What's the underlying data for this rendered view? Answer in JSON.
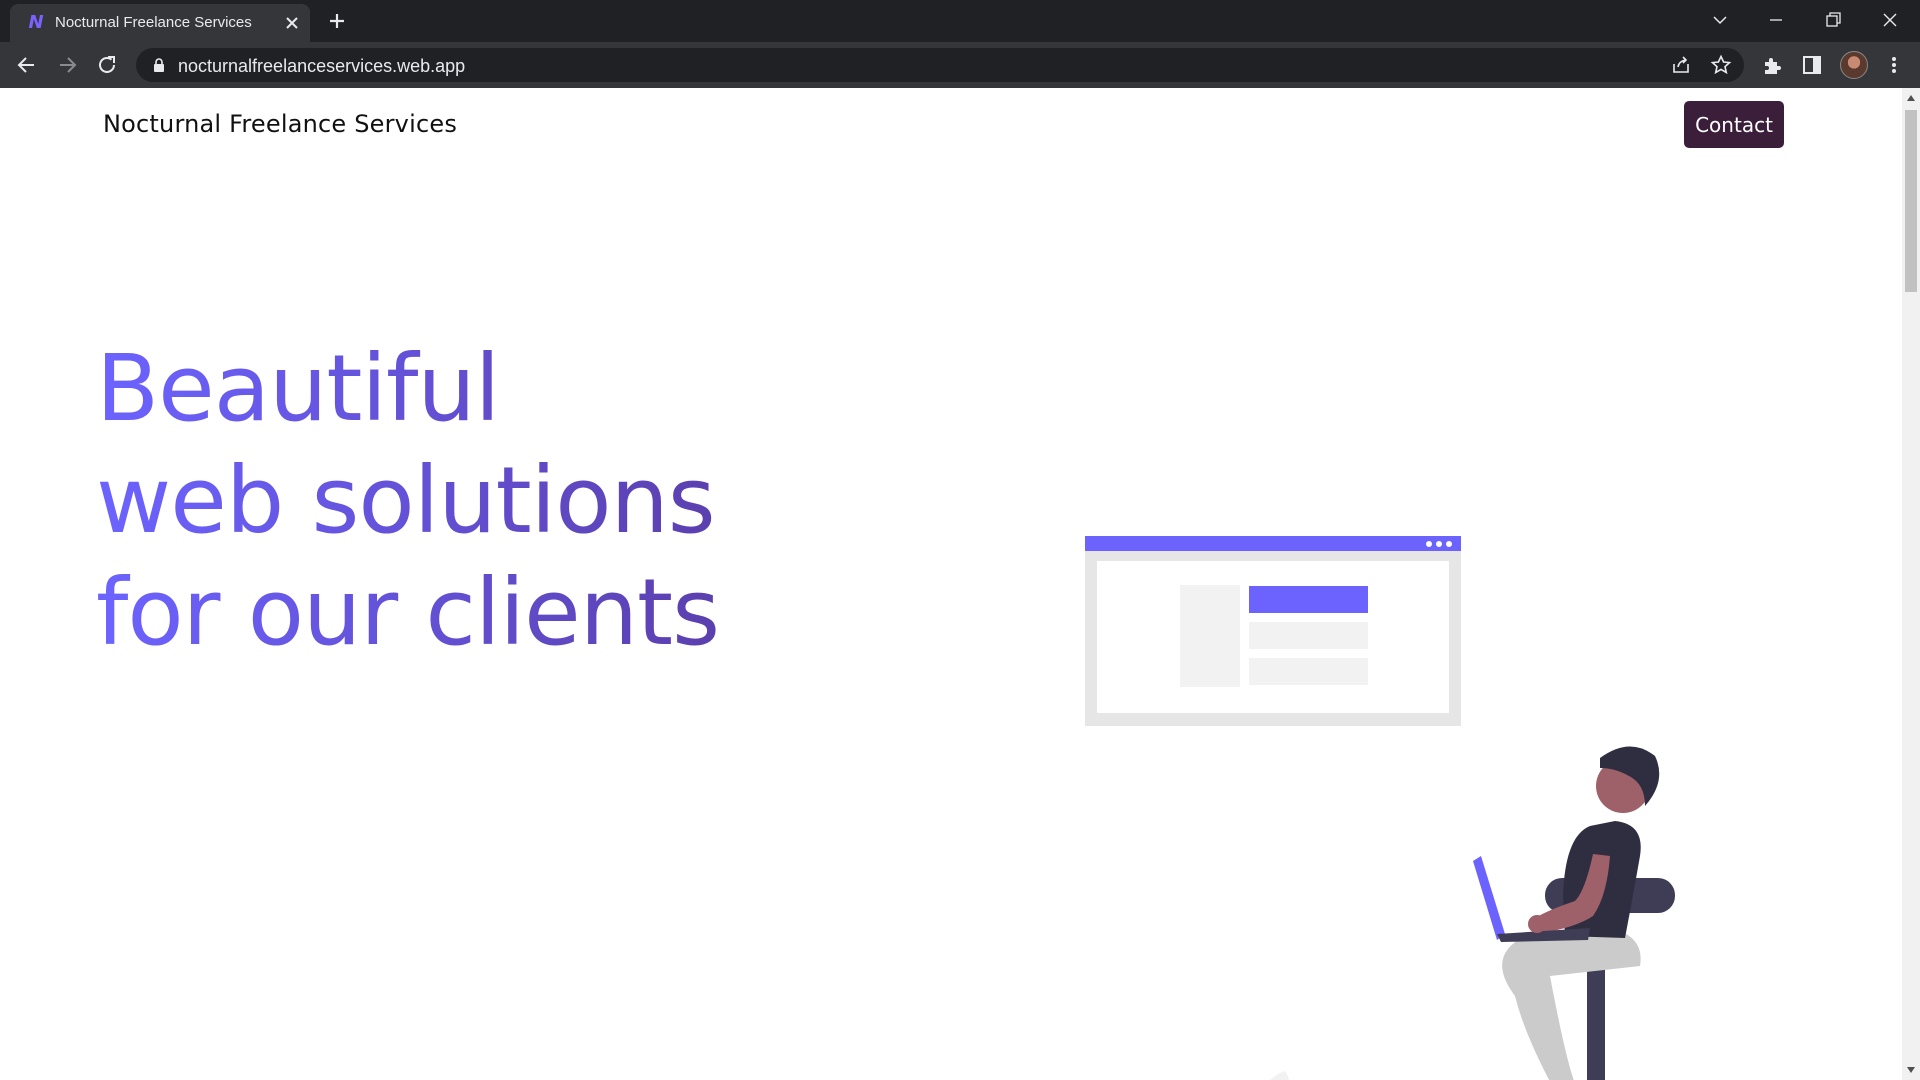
{
  "browser": {
    "tab_title": "Nocturnal Freelance Services",
    "favicon_letter": "N",
    "url": "nocturnalfreelanceservices.web.app",
    "icons": [
      "close-icon",
      "plus-icon",
      "chevron-down-icon",
      "minimize-icon",
      "restore-icon",
      "window-close-icon",
      "back-arrow-icon",
      "forward-arrow-icon",
      "reload-icon",
      "lock-icon",
      "share-icon",
      "star-icon",
      "extensions-icon",
      "side-panel-icon",
      "avatar",
      "more-vert-icon"
    ]
  },
  "site": {
    "brand": "Nocturnal Freelance Services",
    "contact_label": "Contact",
    "hero": {
      "line1": "Beautiful",
      "line2": "web solutions",
      "line3": "for our clients"
    }
  },
  "colors": {
    "accent": "#6c63ff",
    "accent_dark": "#5b3fae",
    "contact_bg": "#3b1f3a",
    "chrome_dark": "#202124",
    "chrome_toolbar": "#35363a"
  }
}
